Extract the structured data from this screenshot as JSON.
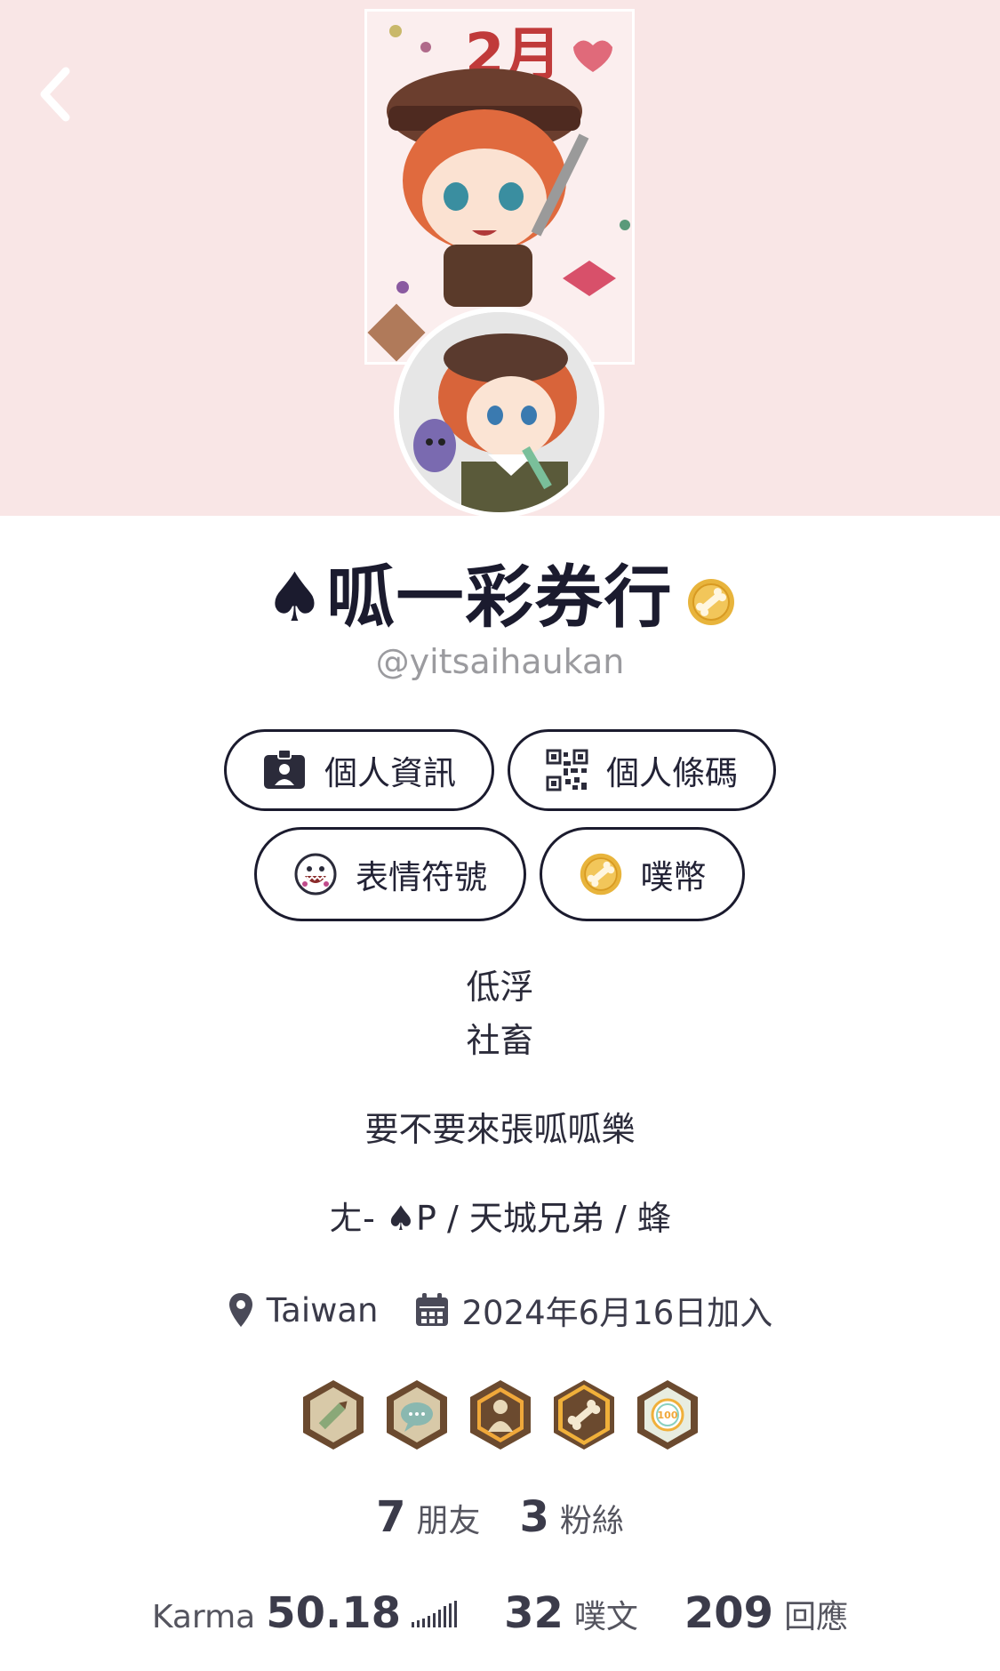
{
  "profile": {
    "display_name": "♠呱一彩券行",
    "handle": "@yitsaihaukan"
  },
  "buttons": {
    "info": "個人資訊",
    "barcode": "個人條碼",
    "emoticons": "表情符號",
    "coins": "噗幣"
  },
  "bio": {
    "line1": "低浮",
    "line2": "社畜",
    "line3": "要不要來張呱呱樂",
    "line4": "ㄤ- ♠P / 天城兄弟 / 蜂"
  },
  "meta": {
    "location": "Taiwan",
    "joined": "2024年6月16日加入"
  },
  "banner": {
    "month_text": "2月"
  },
  "badges": [
    "pencil-badge",
    "chat-badge",
    "profile-badge",
    "bone-badge",
    "hundred-badge"
  ],
  "badge_hundred_text": "100",
  "stats": {
    "friends_count": "7",
    "friends_label": "朋友",
    "fans_count": "3",
    "fans_label": "粉絲",
    "karma_label": "Karma",
    "karma_value": "50.18",
    "plurks_count": "32",
    "plurks_label": "噗文",
    "replies_count": "209",
    "replies_label": "回應"
  },
  "colors": {
    "header_bg": "#f9e6e6",
    "accent_gold": "#e8b43c",
    "badge_brown": "#6b4a2f"
  }
}
